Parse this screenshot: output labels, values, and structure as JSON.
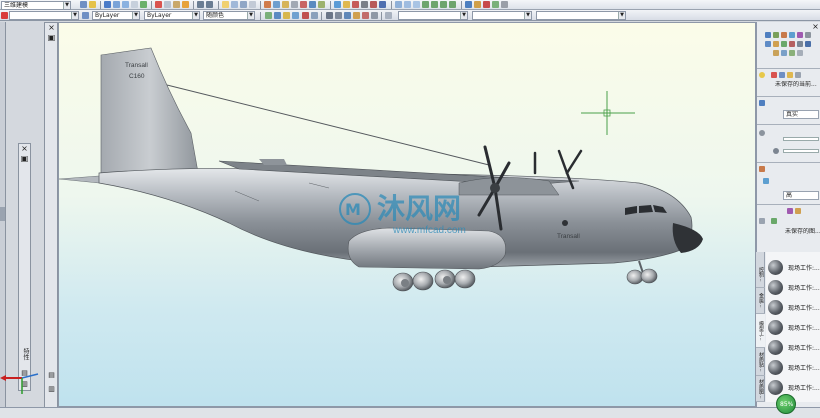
{
  "toolbar": {
    "workspace": "三维建模",
    "layer_combo": "",
    "color_combo": "ByLayer",
    "linetype_combo": "ByLayer",
    "plotstyle_combo": "随颜色"
  },
  "left_panels": {
    "properties_tab": "特性"
  },
  "viewport": {
    "aircraft_tail_brand": "Transall",
    "aircraft_tail_model": "C160",
    "aircraft_fuselage_brand": "Transall",
    "watermark_main": "沐风网",
    "watermark_url": "www.mfcad.com"
  },
  "right_panel": {
    "unsaved_light": "未保存的当前...",
    "visual_style": "真实",
    "shadow_quality": "高",
    "unsaved_background": "未保存的图...",
    "palette_tabs": [
      "控制...",
      "金属...",
      "模型工...",
      "材质贴...",
      "材质图..."
    ],
    "palette_items": [
      "现场工作:...",
      "现场工作:...",
      "现场工作:...",
      "现场工作:...",
      "现场工作:...",
      "现场工作:...",
      "现场工作:..."
    ]
  },
  "status": {
    "badge": "85%"
  },
  "colors": {
    "viewport_top": "#fbfce9",
    "viewport_bottom": "#bfe2ee",
    "fuselage": "#9a9fa5",
    "crosshair": "#4aa04a",
    "watermark": "#2a8ab8"
  }
}
